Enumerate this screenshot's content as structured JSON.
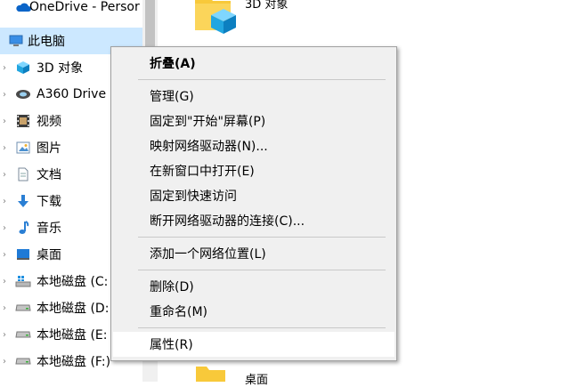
{
  "nav": {
    "items": [
      {
        "label": "OneDrive - Persor",
        "icon": "cloud-icon"
      },
      {
        "label": "此电脑",
        "icon": "computer-icon"
      },
      {
        "label": "3D 对象",
        "icon": "cube-icon"
      },
      {
        "label": "A360 Drive",
        "icon": "a360-icon"
      },
      {
        "label": "视频",
        "icon": "video-icon"
      },
      {
        "label": "图片",
        "icon": "picture-icon"
      },
      {
        "label": "文档",
        "icon": "document-icon"
      },
      {
        "label": "下载",
        "icon": "download-icon"
      },
      {
        "label": "音乐",
        "icon": "music-icon"
      },
      {
        "label": "桌面",
        "icon": "desktop-icon"
      },
      {
        "label": "本地磁盘 (C:",
        "icon": "drive-c-icon"
      },
      {
        "label": "本地磁盘 (D:",
        "icon": "drive-icon"
      },
      {
        "label": "本地磁盘 (E:",
        "icon": "drive-icon"
      },
      {
        "label": "本地磁盘 (F:)",
        "icon": "drive-icon"
      }
    ]
  },
  "content": {
    "top_folder_label": "3D 对象",
    "bottom_folder_label": "桌面"
  },
  "menu": {
    "items": [
      {
        "label": "折叠(A)"
      },
      {
        "label": "管理(G)"
      },
      {
        "label": "固定到\"开始\"屏幕(P)"
      },
      {
        "label": "映射网络驱动器(N)..."
      },
      {
        "label": "在新窗口中打开(E)"
      },
      {
        "label": "固定到快速访问"
      },
      {
        "label": "断开网络驱动器的连接(C)..."
      },
      {
        "label": "添加一个网络位置(L)"
      },
      {
        "label": "删除(D)"
      },
      {
        "label": "重命名(M)"
      },
      {
        "label": "属性(R)"
      }
    ]
  },
  "colors": {
    "selected_bg": "#cce8ff",
    "menu_bg": "#f0f0f0",
    "onedrive_blue": "#0a64c8",
    "folder_yellow": "#f8c93a"
  }
}
